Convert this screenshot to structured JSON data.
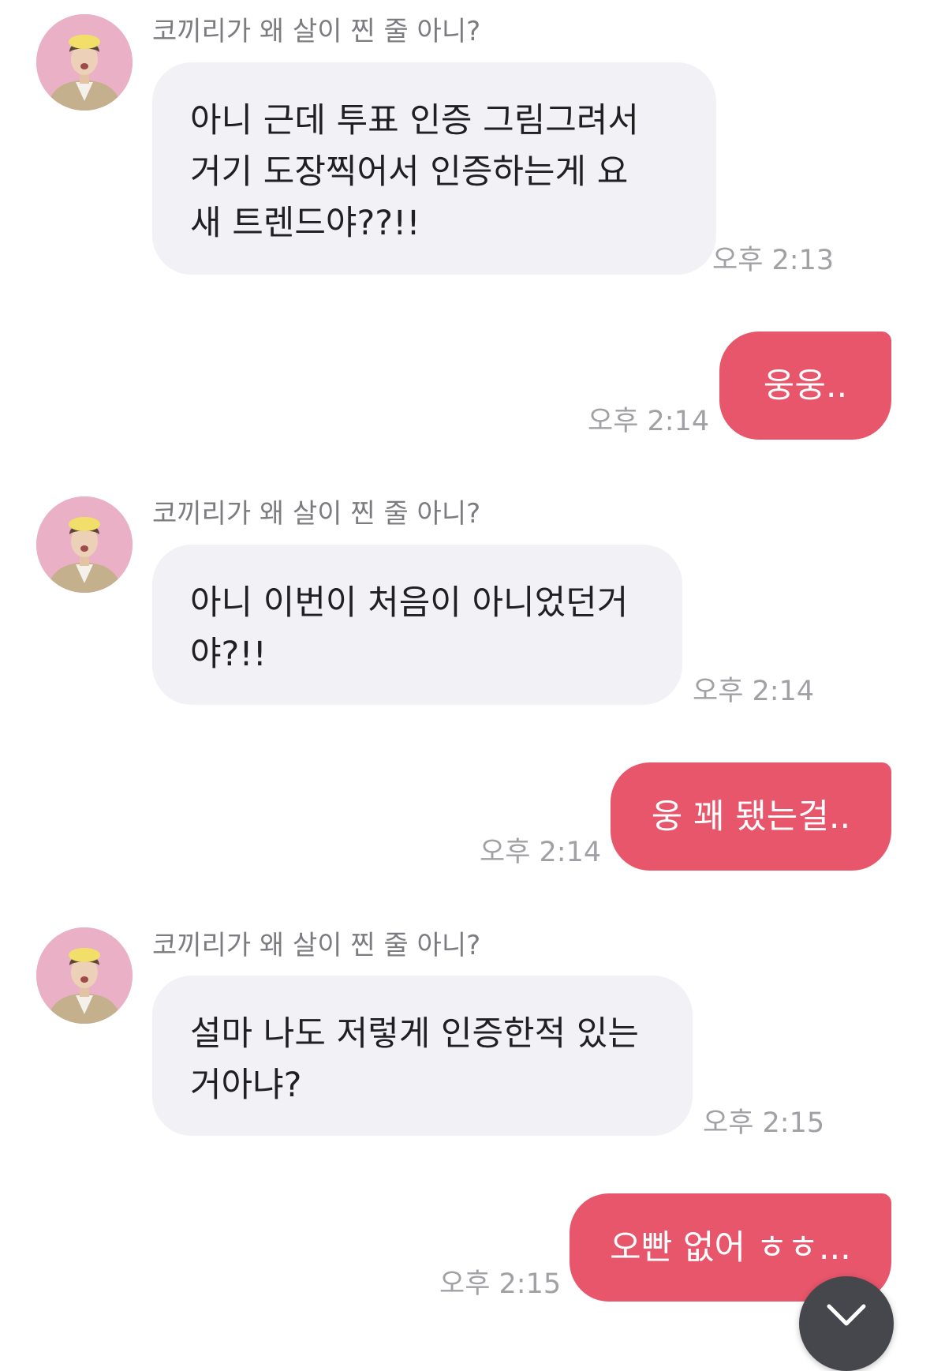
{
  "messages": [
    {
      "direction": "incoming",
      "sender": "코끼리가 왜 살이 찐 줄 아니?",
      "lines": [
        "아니 근데 투표 인증 그림그려서",
        "거기 도장찍어서 인증하는게 요",
        "새 트렌드야??!!"
      ],
      "time": "오후 2:13"
    },
    {
      "direction": "outgoing",
      "text": "웅웅..",
      "time": "오후 2:14"
    },
    {
      "direction": "incoming",
      "sender": "코끼리가 왜 살이 찐 줄 아니?",
      "lines": [
        "아니 이번이 처음이 아니었던거",
        "야?!!"
      ],
      "time": "오후 2:14"
    },
    {
      "direction": "outgoing",
      "text": "웅 꽤 됐는걸..",
      "time": "오후 2:14"
    },
    {
      "direction": "incoming",
      "sender": "코끼리가 왜 살이 찐 줄 아니?",
      "lines": [
        "설마 나도 저렇게 인증한적 있는",
        "거아냐?"
      ],
      "time": "오후 2:15"
    },
    {
      "direction": "outgoing",
      "text": "오빤 없어 ㅎㅎ...",
      "time": "오후 2:15"
    }
  ],
  "colors": {
    "outgoing_bubble": "#e8566b",
    "incoming_bubble": "#f2f2f6",
    "timestamp": "#a1a1a5",
    "sender_name": "#7c7c80"
  },
  "icons": {
    "avatar": "profile-photo",
    "scroll_down": "chevron-down-icon"
  }
}
